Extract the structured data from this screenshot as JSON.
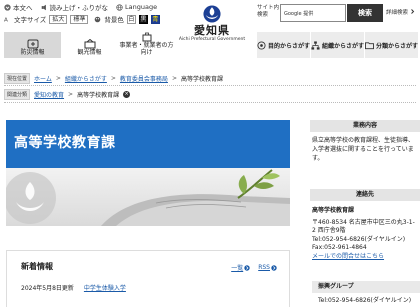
{
  "utility": {
    "home_label": "本文へ",
    "furigana_label": "読み上げ・ふりがな",
    "language_label": "Language",
    "text_size_label": "文字サイズ",
    "enlarge_label": "拡大",
    "standard_label": "標準",
    "bg_color_label": "背景色",
    "bg_white": "白",
    "bg_black": "黒",
    "bg_blue": "青"
  },
  "logo": {
    "name": "愛知県",
    "english": "Aichi Prefectural Government"
  },
  "search": {
    "site_label": "サイト内検索",
    "placeholder": "Google 提供",
    "button_label": "検索",
    "advanced_label": "詳細検索"
  },
  "nav_left": [
    {
      "label": "防災情報",
      "icon": "shield-icon",
      "active": true
    },
    {
      "label": "観光情報",
      "icon": "tourism-icon",
      "active": false
    },
    {
      "label": "事業者・就業者の方向け",
      "icon": "business-icon",
      "active": false
    }
  ],
  "nav_right": [
    {
      "label": "目的からさがす",
      "icon": "target-icon"
    },
    {
      "label": "組織からさがす",
      "icon": "org-icon"
    },
    {
      "label": "分類からさがす",
      "icon": "folder-icon"
    }
  ],
  "breadcrumbs": {
    "current_tag": "現在位置",
    "items": [
      "ホーム",
      "組織からさがす",
      "教育委員会事務局",
      "高等学校教育課"
    ],
    "related_tag": "関連分類",
    "related_items": [
      "愛知の教育",
      "高等学校教育課"
    ]
  },
  "page_title": "高等学校教育課",
  "news": {
    "title": "新着情報",
    "list_label": "一覧",
    "rss_label": "RSS",
    "items": [
      {
        "date": "2024年5月8日更新",
        "text": "中学生体験入学"
      }
    ]
  },
  "sidebar": {
    "business_heading": "業務内容",
    "business_text": "県立高等学校の教育課程、生徒指導、入学者選抜に関することを行っています。",
    "contact_heading": "連絡先",
    "org_name": "高等学校教育課",
    "address": "〒460-8534 名古屋市中区三の丸3-1-2 西庁舎9階",
    "tel": "Tel:052-954-6826(ダイヤルイン)",
    "fax": "Fax:052-961-4864",
    "mail_link": "メールでの問合せはこちら",
    "group_heading": "振興グループ",
    "group_tel": "Tel:052-954-6826(ダイヤルイン)"
  },
  "colors": {
    "title_band": "#1f6fc3",
    "link": "#1a5aa8"
  }
}
